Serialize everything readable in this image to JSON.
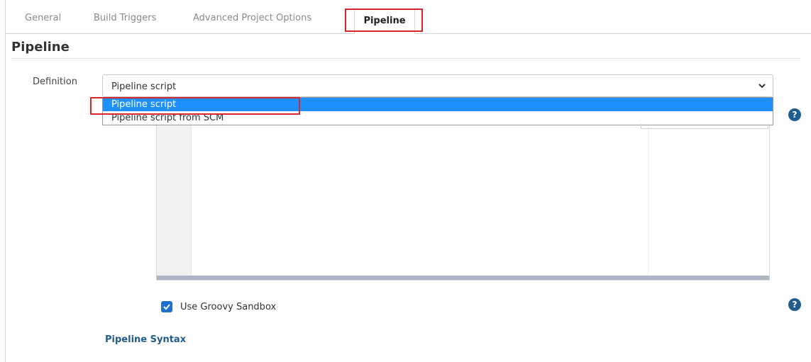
{
  "tabs": [
    {
      "label": "General",
      "active": false
    },
    {
      "label": "Build Triggers",
      "active": false
    },
    {
      "label": "Advanced Project Options",
      "active": false
    },
    {
      "label": "Pipeline",
      "active": true
    }
  ],
  "section": {
    "title": "Pipeline"
  },
  "definition": {
    "label": "Definition",
    "selected": "Pipeline script",
    "options": [
      "Pipeline script",
      "Pipeline script from SCM"
    ]
  },
  "sandbox": {
    "label": "Use Groovy Sandbox",
    "checked": true
  },
  "links": {
    "pipeline_syntax": "Pipeline Syntax"
  },
  "icons": {
    "help": "?"
  },
  "colors": {
    "highlight": "#d8262d",
    "selected_option": "#1e90ff",
    "help": "#215d8c",
    "checkbox": "#1e6fcf"
  }
}
